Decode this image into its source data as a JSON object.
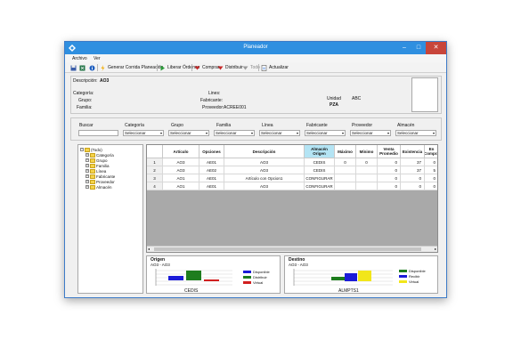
{
  "window": {
    "title": "Planeador"
  },
  "menu": [
    "Archivo",
    "Ver"
  ],
  "toolbar": {
    "generar": "Generar Corrida Planeación",
    "liberar": "Liberar Órdenes",
    "comprar": "Comprar",
    "distribuir": "Distribuir",
    "todo": "Todo",
    "actualizar": "Actualizar"
  },
  "info": {
    "descripcion_label": "Descripción:",
    "descripcion_value": "AO3",
    "categoria_label": "Categoría:",
    "grupo_label": "Grupo:",
    "familia_label": "Familia:",
    "lines_label": "Lines:",
    "fabricante_label": "Fabricante:",
    "proveedor_label": "Proveedor:",
    "proveedor_value": "ACREE001",
    "unidad_label": "Unidad",
    "unidad_value": "ABC",
    "pza": "PZA"
  },
  "filters": {
    "buscar_label": "Buscar",
    "buscar_value": "",
    "dropdowns": [
      {
        "label": "Categoría",
        "value": "Seleccionar"
      },
      {
        "label": "Grupo",
        "value": "Seleccionar"
      },
      {
        "label": "Familia",
        "value": "Seleccionar"
      },
      {
        "label": "Línea",
        "value": "Seleccionar"
      },
      {
        "label": "Fabricante",
        "value": "Seleccionar"
      },
      {
        "label": "Proveedor",
        "value": "Seleccionar"
      },
      {
        "label": "Almacén",
        "value": "Seleccionar"
      }
    ]
  },
  "tree": {
    "root": "(Todo)",
    "items": [
      "Categoría",
      "Grupo",
      "Familia",
      "Línea",
      "Fabricante",
      "Proveedor",
      "Almacén"
    ]
  },
  "table": {
    "headers": [
      "",
      "Artículo",
      "Opciones",
      "Descripción",
      "Almacén Origen",
      "Máximo",
      "Mínimo",
      "Venta Promedio",
      "Existencia",
      "En Compra"
    ],
    "rows": [
      [
        "1",
        "AO3",
        "AE01",
        "AO3",
        "CEDIS",
        "0",
        "0",
        "0",
        "37",
        "0"
      ],
      [
        "2",
        "AO3",
        "AE02",
        "AO3",
        "CEDIS",
        "",
        "",
        "0",
        "37",
        "5"
      ],
      [
        "3",
        "AO1",
        "AE01",
        "Artículo con Opcion1",
        "CONFIGURAR",
        "",
        "",
        "0",
        "0",
        "0"
      ],
      [
        "4",
        "AO1",
        "AE01",
        "AO3",
        "CONFIGURAR",
        "",
        "",
        "0",
        "0",
        "0"
      ]
    ]
  },
  "origen": {
    "title": "Origen",
    "sub": "AO3 - AO3",
    "label": "CEDIS",
    "legend": [
      "Disponible",
      "Distribuir",
      "Virtual"
    ],
    "colors": [
      "#1b1bd8",
      "#1e7d1e",
      "#d11f1f"
    ]
  },
  "destino": {
    "title": "Destino",
    "sub": "AO3 - AO3",
    "label": "ALMPTS1",
    "legend": [
      "Disponible",
      "Recibir",
      "Virtual"
    ],
    "colors": [
      "#1e7d1e",
      "#1b1bd8",
      "#f2e61a"
    ]
  }
}
